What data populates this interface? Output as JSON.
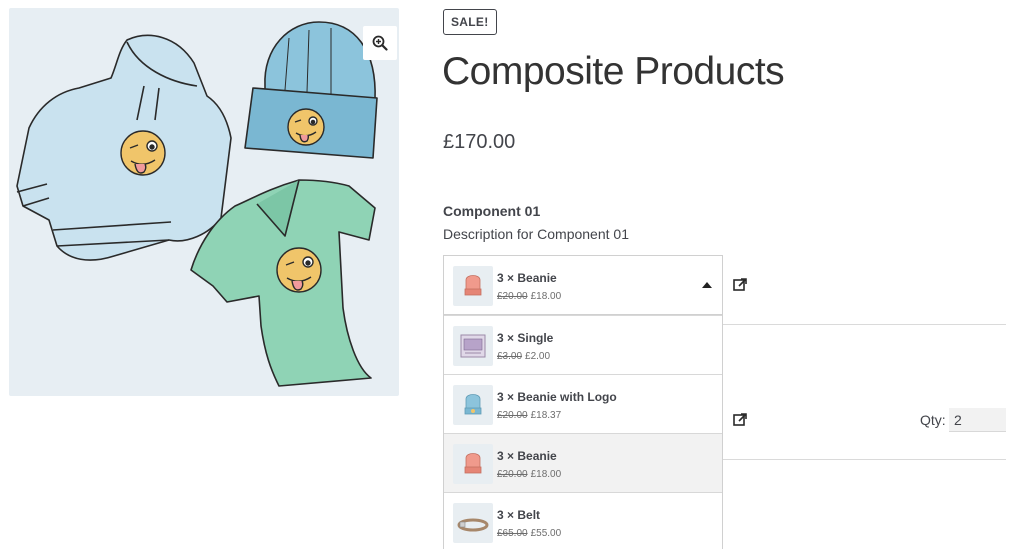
{
  "gallery": {
    "zoom_icon": "magnify-plus-icon"
  },
  "product": {
    "badge": "SALE!",
    "title": "Composite Products",
    "price": "£170.00"
  },
  "component": {
    "title": "Component 01",
    "description": "Description for Component 01",
    "selected": {
      "name": "3 × Beanie",
      "old_price": "£20.00",
      "new_price": "£18.00"
    },
    "options": [
      {
        "name": "3 × Single",
        "old_price": "£3.00",
        "new_price": "£2.00"
      },
      {
        "name": "3 × Beanie with Logo",
        "old_price": "£20.00",
        "new_price": "£18.37"
      },
      {
        "name": "3 × Beanie",
        "old_price": "£20.00",
        "new_price": "£18.00"
      },
      {
        "name": "3 × Belt",
        "old_price": "£65.00",
        "new_price": "£55.00"
      }
    ]
  },
  "quantity": {
    "label": "Qty:",
    "value": "2"
  },
  "colors": {
    "beanie_pink": "#f09a8c",
    "beanie_blue": "#8cc4dc",
    "hoodie": "#c9e2ef",
    "tshirt": "#8fd3b5"
  }
}
